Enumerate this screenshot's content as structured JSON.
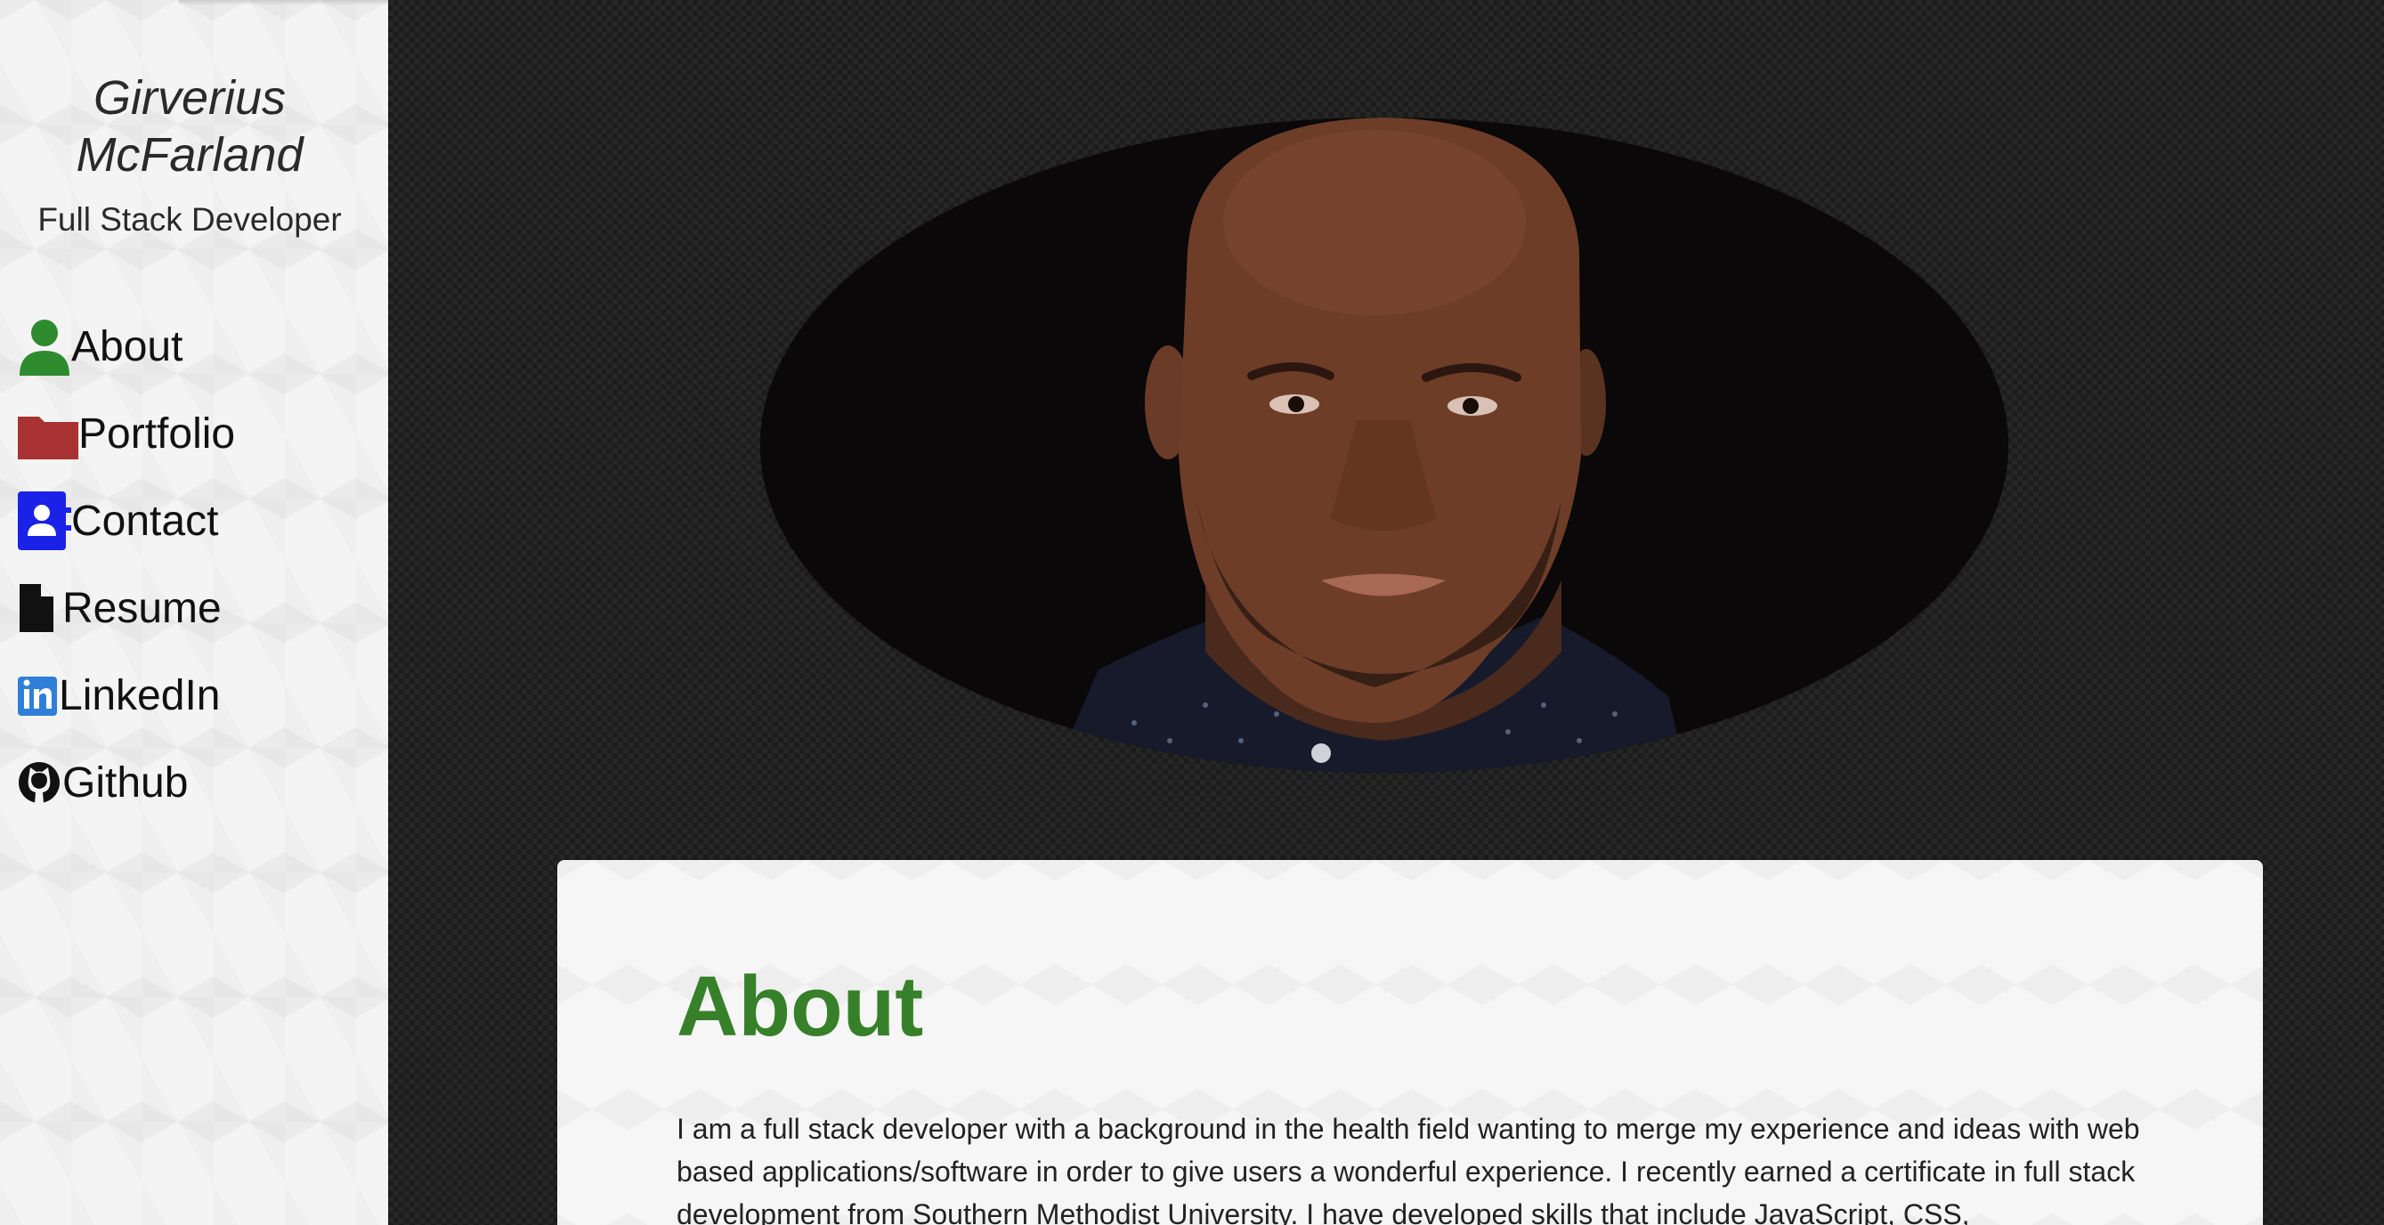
{
  "sidebar": {
    "name": "Girverius McFarland",
    "role": "Full Stack Developer",
    "nav": [
      {
        "label": "About",
        "icon": "user-icon",
        "color": "#2e8b2e"
      },
      {
        "label": "Portfolio",
        "icon": "folder-icon",
        "color": "#a83232"
      },
      {
        "label": "Contact",
        "icon": "contact-card-icon",
        "color": "#1a22e8"
      },
      {
        "label": "Resume",
        "icon": "file-icon",
        "color": "#111111"
      },
      {
        "label": "LinkedIn",
        "icon": "linkedin-icon",
        "color": "#2f7fd8"
      },
      {
        "label": "Github",
        "icon": "github-icon",
        "color": "#111111"
      }
    ]
  },
  "main": {
    "about": {
      "heading": "About",
      "body": "I am a full stack developer with a background in the health field wanting to merge my experience and ideas with web based applications/software in order to give users a wonderful experience. I recently earned a certificate in full stack development from Southern Methodist University. I have developed skills that include JavaScript, CSS,"
    }
  },
  "colors": {
    "accent_green": "#36802a",
    "sidebar_bg": "#f4f4f4",
    "main_bg": "#262626"
  }
}
